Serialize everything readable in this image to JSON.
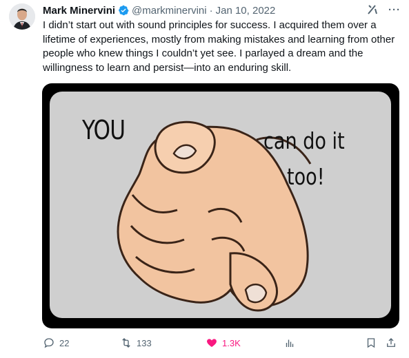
{
  "author": {
    "name": "Mark Minervini",
    "handle": "@markminervini",
    "date": "Jan 10, 2022",
    "separator": "·"
  },
  "tweet": {
    "text": "I didn’t start out with sound principles for success. I acquired them over a lifetime of experiences, mostly from making mistakes and learning from other people who knew things I couldn’t yet see. I parlayed a dream and the willingness to learn and persist—into an enduring skill."
  },
  "image": {
    "word_you": "YOU",
    "word_cando": "can do it",
    "word_too": "too!"
  },
  "actions": {
    "replies": "22",
    "reposts": "133",
    "likes": "1.3K"
  },
  "colors": {
    "like": "#f91880",
    "verified": "#1d9bf0",
    "muted": "#536471"
  },
  "icons": [
    "verified-badge-icon",
    "grok-icon",
    "more-icon",
    "reply-icon",
    "repost-icon",
    "heart-icon",
    "views-icon",
    "bookmark-icon",
    "share-icon"
  ]
}
